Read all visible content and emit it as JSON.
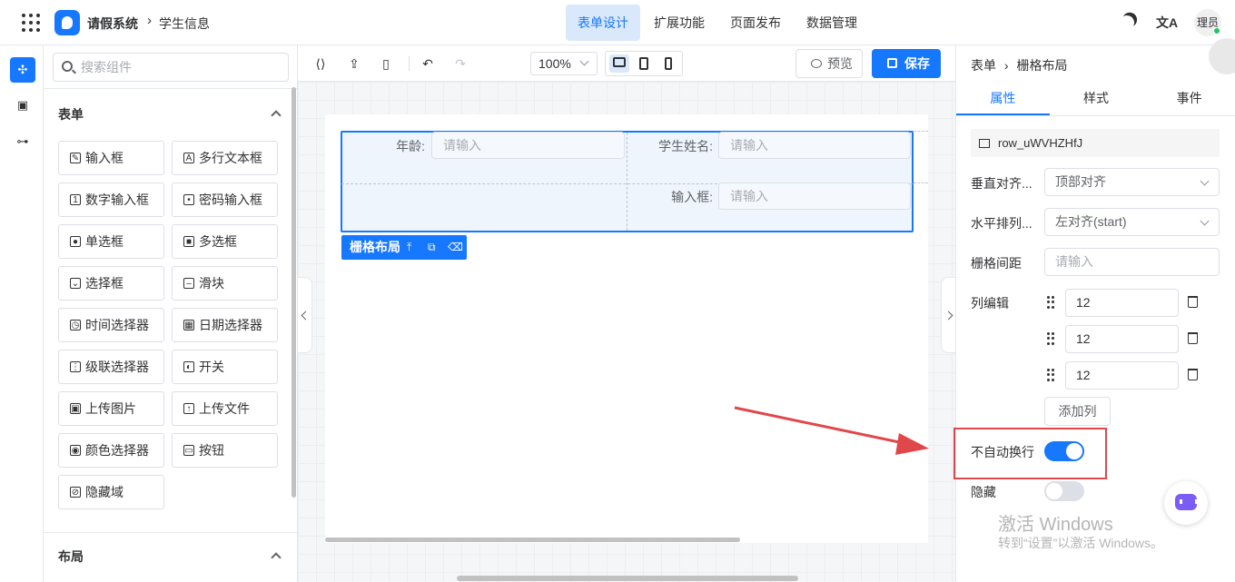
{
  "header": {
    "app_title": "请假系统",
    "breadcrumb_sep": "›",
    "breadcrumb": "学生信息",
    "nav": [
      "表单设计",
      "扩展功能",
      "页面发布",
      "数据管理"
    ],
    "active_nav": "表单设计",
    "translate_icon": "文A",
    "avatar_text": "理员"
  },
  "components": {
    "search_placeholder": "搜索组件",
    "form_section": "表单",
    "layout_section": "布局",
    "items": [
      {
        "label": "输入框",
        "icon": "pencil-icon",
        "glyph": "✎"
      },
      {
        "label": "多行文本框",
        "icon": "textarea-icon",
        "glyph": "A"
      },
      {
        "label": "数字输入框",
        "icon": "number-icon",
        "glyph": "1"
      },
      {
        "label": "密码输入框",
        "icon": "lock-icon",
        "glyph": "•"
      },
      {
        "label": "单选框",
        "icon": "radio-icon",
        "glyph": "●"
      },
      {
        "label": "多选框",
        "icon": "checkbox-icon",
        "glyph": "■"
      },
      {
        "label": "选择框",
        "icon": "select-icon",
        "glyph": "⌄"
      },
      {
        "label": "滑块",
        "icon": "slider-icon",
        "glyph": "–"
      },
      {
        "label": "时间选择器",
        "icon": "clock-icon",
        "glyph": "◷"
      },
      {
        "label": "日期选择器",
        "icon": "calendar-icon",
        "glyph": "▦"
      },
      {
        "label": "级联选择器",
        "icon": "cascader-icon",
        "glyph": "⋮"
      },
      {
        "label": "开关",
        "icon": "toggle-icon",
        "glyph": "◐"
      },
      {
        "label": "上传图片",
        "icon": "image-icon",
        "glyph": "▣"
      },
      {
        "label": "上传文件",
        "icon": "upload-icon",
        "glyph": "↑"
      },
      {
        "label": "颜色选择器",
        "icon": "palette-icon",
        "glyph": "◉"
      },
      {
        "label": "按钮",
        "icon": "button-icon",
        "glyph": "▭"
      },
      {
        "label": "隐藏域",
        "icon": "eye-off-icon",
        "glyph": "⊘"
      }
    ]
  },
  "toolbar": {
    "zoom": "100%",
    "preview_label": "预览",
    "save_label": "保存"
  },
  "canvas": {
    "field_age_label": "年龄:",
    "field_age_placeholder": "请输入",
    "field_name_label": "学生姓名:",
    "field_name_placeholder": "请输入",
    "field_input_label": "输入框:",
    "field_input_placeholder": "请输入",
    "grid_tag_label": "栅格布局"
  },
  "properties": {
    "breadcrumb_root": "表单",
    "breadcrumb_sep": "›",
    "breadcrumb_current": "栅格布局",
    "tabs": [
      "属性",
      "样式",
      "事件"
    ],
    "active_tab": "属性",
    "component_id": "row_uWVHZHfJ",
    "vertical_align_label": "垂直对齐...",
    "vertical_align_value": "顶部对齐",
    "horizontal_label": "水平排列...",
    "horizontal_value": "左对齐(start)",
    "gutter_label": "栅格间距",
    "gutter_placeholder": "请输入",
    "columns_label": "列编辑",
    "columns": [
      "12",
      "12",
      "12"
    ],
    "add_column_label": "添加列",
    "nowrap_label": "不自动换行",
    "nowrap_on": true,
    "hidden_label": "隐藏",
    "hidden_on": false
  },
  "watermark": {
    "line1": "激活 Windows",
    "line2": "转到“设置”以激活 Windows。"
  },
  "colors": {
    "accent": "#1677ff",
    "highlight_red": "#e0474b"
  }
}
